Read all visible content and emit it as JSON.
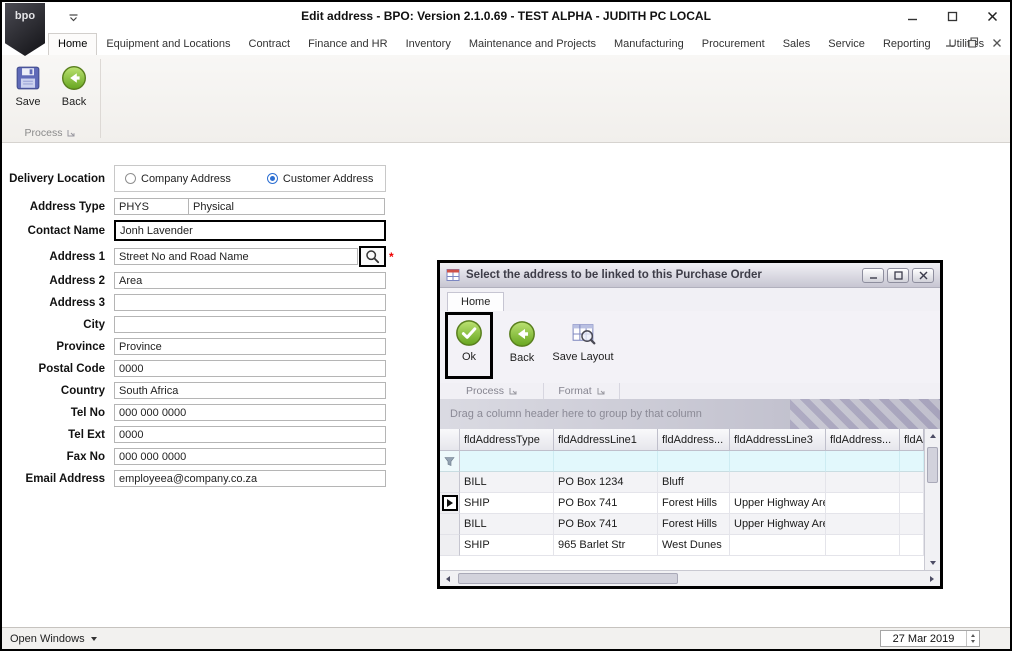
{
  "titlebar": {
    "title": "Edit address - BPO: Version 2.1.0.69 - TEST ALPHA - JUDITH PC LOCAL",
    "logo_text": "bpo"
  },
  "ribbon": {
    "tabs": [
      "Home",
      "Equipment and Locations",
      "Contract",
      "Finance and HR",
      "Inventory",
      "Maintenance and Projects",
      "Manufacturing",
      "Procurement",
      "Sales",
      "Service",
      "Reporting",
      "Utilities"
    ],
    "active_tab": "Home",
    "save_label": "Save",
    "back_label": "Back",
    "group_label": "Process"
  },
  "icons": {
    "save": "floppy-disk",
    "back": "green-circle-left-arrow",
    "ok": "green-circle-check",
    "save_layout": "grid-with-magnifier",
    "address_lookup": "magnifier"
  },
  "form": {
    "delivery_location": {
      "label": "Delivery Location",
      "options": [
        {
          "label": "Company Address",
          "selected": false
        },
        {
          "label": "Customer Address",
          "selected": true
        }
      ]
    },
    "address_type": {
      "label": "Address Type",
      "code": "PHYS",
      "description": "Physical"
    },
    "contact_name": {
      "label": "Contact Name",
      "value": "Jonh Lavender"
    },
    "address_1": {
      "label": "Address 1",
      "value": "Street No and Road Name",
      "required_marker": "*"
    },
    "address_2": {
      "label": "Address 2",
      "value": "Area"
    },
    "address_3": {
      "label": "Address 3",
      "value": ""
    },
    "city": {
      "label": "City",
      "value": ""
    },
    "province": {
      "label": "Province",
      "value": "Province"
    },
    "postal_code": {
      "label": "Postal Code",
      "value": "0000"
    },
    "country": {
      "label": "Country",
      "value": "South Africa"
    },
    "tel_no": {
      "label": "Tel No",
      "value": "000 000 0000"
    },
    "tel_ext": {
      "label": "Tel Ext",
      "value": "0000"
    },
    "fax_no": {
      "label": "Fax No",
      "value": "000 000 0000"
    },
    "email_address": {
      "label": "Email Address",
      "value": "employeea@company.co.za"
    }
  },
  "dialog": {
    "title": "Select the address to be linked to this Purchase Order",
    "tab": "Home",
    "ok_label": "Ok",
    "back_label": "Back",
    "save_layout_label": "Save Layout",
    "process_group_label": "Process",
    "format_group_label": "Format",
    "group_by_hint": "Drag a column header here to group by that column",
    "grid": {
      "columns": [
        "fldAddressType",
        "fldAddressLine1",
        "fldAddress...",
        "fldAddressLine3",
        "fldAddress...",
        "fldAd..."
      ],
      "rows": [
        [
          "BILL",
          "PO Box 1234",
          "Bluff",
          "",
          "",
          ""
        ],
        [
          "SHIP",
          "PO Box 741",
          "Forest Hills",
          "Upper Highway Area",
          "",
          ""
        ],
        [
          "BILL",
          "PO Box 741",
          "Forest Hills",
          "Upper Highway Area",
          "",
          ""
        ],
        [
          "SHIP",
          "965 Barlet Str",
          "West Dunes",
          "",
          "",
          ""
        ]
      ],
      "selected_row_index": 1
    }
  },
  "statusbar": {
    "open_windows_label": "Open Windows",
    "date": "27 Mar 2019"
  }
}
